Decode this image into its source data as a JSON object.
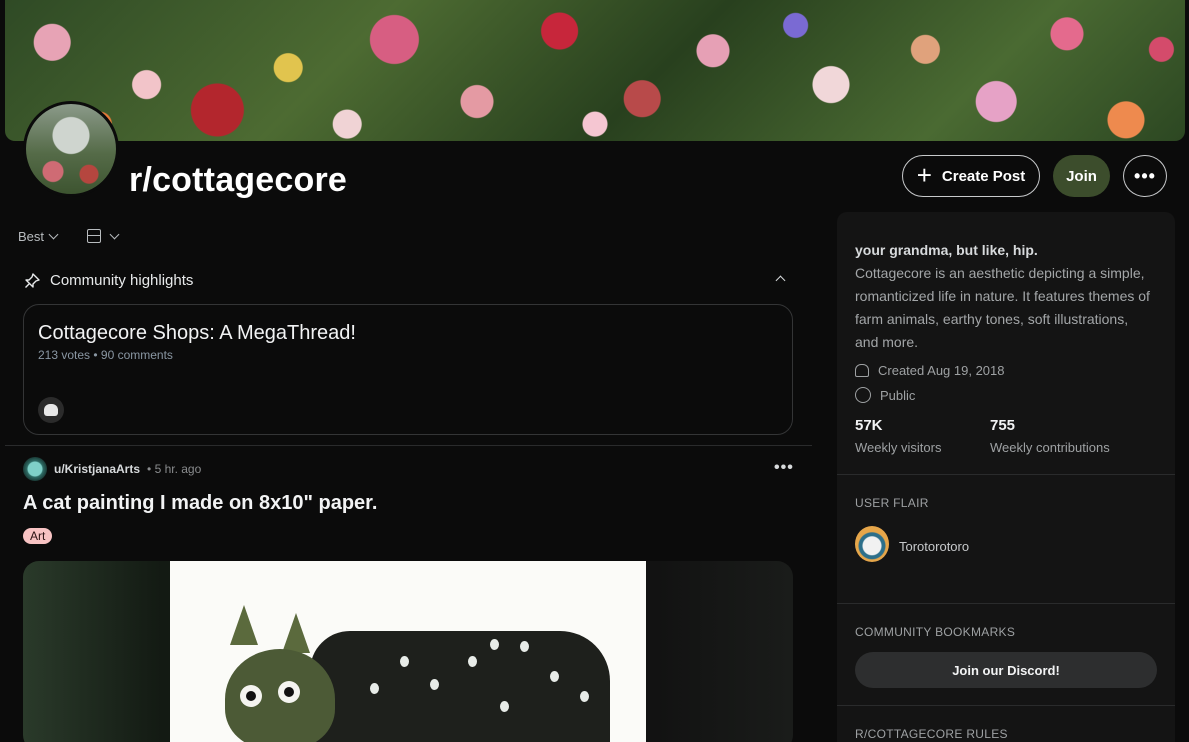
{
  "header": {
    "subreddit": "r/cottagecore",
    "create_post": "Create Post",
    "join": "Join",
    "more": "•••"
  },
  "feed": {
    "sort_label": "Best",
    "highlights": {
      "label": "Community highlights",
      "card_title": "Cottagecore Shops: A MegaThread!",
      "card_meta": "213 votes • 90 comments"
    },
    "post": {
      "user": "u/KristjanaArts",
      "time": "• 5 hr. ago",
      "title": "A cat painting I made on 8x10\" paper.",
      "flair": "Art",
      "more": "•••"
    }
  },
  "sidebar": {
    "tagline": "your grandma, but like, hip.",
    "description": "Cottagecore is an aesthetic depicting a simple, romanticized life in nature. It features themes of farm animals, earthy tones, soft illustrations, and more.",
    "created": "Created Aug 19, 2018",
    "visibility": "Public",
    "stats": [
      {
        "value": "57K",
        "label": "Weekly visitors"
      },
      {
        "value": "755",
        "label": "Weekly contributions"
      }
    ],
    "user_flair_header": "USER FLAIR",
    "user_flair_name": "Torotorotoro",
    "bookmarks_header": "COMMUNITY BOOKMARKS",
    "discord_button": "Join our Discord!",
    "rules_header": "R/COTTAGECORE RULES"
  },
  "colors": {
    "background": "#0b0b0b",
    "join_button": "#3c4d2c",
    "flair_art": "#f8c3c3",
    "sidebar": "#141414"
  }
}
